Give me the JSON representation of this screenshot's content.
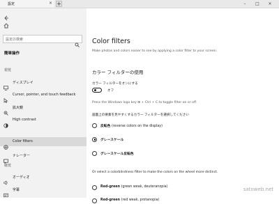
{
  "window": {
    "tab_title": "設定",
    "new_tab_symbol": "+",
    "close_tab_symbol": "×",
    "minimize_symbol": "–",
    "maximize_symbol": "□",
    "close_symbol": "×"
  },
  "sidebar": {
    "search_placeholder": "設定の検索",
    "title": "簡単操作",
    "vision_header": "視覚",
    "vision_items": [
      {
        "label": "ディスプレイ",
        "icon": "display-icon"
      },
      {
        "label": "Cursor, pointer, and touch feedback",
        "icon": "cursor-icon"
      },
      {
        "label": "拡大鏡",
        "icon": "magnifier-icon"
      },
      {
        "label": "High contrast",
        "icon": "contrast-icon"
      },
      {
        "label": "Color filters",
        "icon": "color-filter-icon",
        "selected": true
      },
      {
        "label": "ナレーター",
        "icon": "narrator-icon"
      }
    ],
    "hearing_header": "聴覚",
    "hearing_items": [
      {
        "label": "オーディオ",
        "icon": "speaker-icon"
      },
      {
        "label": "字幕",
        "icon": "captions-icon"
      }
    ]
  },
  "main": {
    "title": "Color filters",
    "description": "Make photos and colors easier to see by applying a color filter to your screen.",
    "section_title": "カラー フィルターの使用",
    "toggle_label": "カラー フィルターをオンにする",
    "toggle_state": "オフ",
    "toggle_on": false,
    "shortcut_hint": "Press the Windows logo key ⊞ + Ctrl + C to toggle filter on or off.",
    "filter_group_label": "画面上の要素を見やすくするカラー フィルターを選択してください",
    "filters": [
      {
        "name": "反転色",
        "desc": "(reverse colors on the display)",
        "selected": false
      },
      {
        "name": "グレースケール",
        "desc": "",
        "selected": true
      },
      {
        "name": "グレースケール反転色",
        "desc": "",
        "selected": false
      }
    ],
    "colorblind_intro": "Or select a colorblindness filter to make the colors on the wheel more distinct.",
    "colorblind_filters": [
      {
        "name": "Red-green",
        "desc": "(green weak, deuteranopia)",
        "selected": false
      },
      {
        "name": "Red-green",
        "desc": "(red weak, protanopia)",
        "selected": false
      }
    ]
  },
  "watermark": "satoweb.net"
}
